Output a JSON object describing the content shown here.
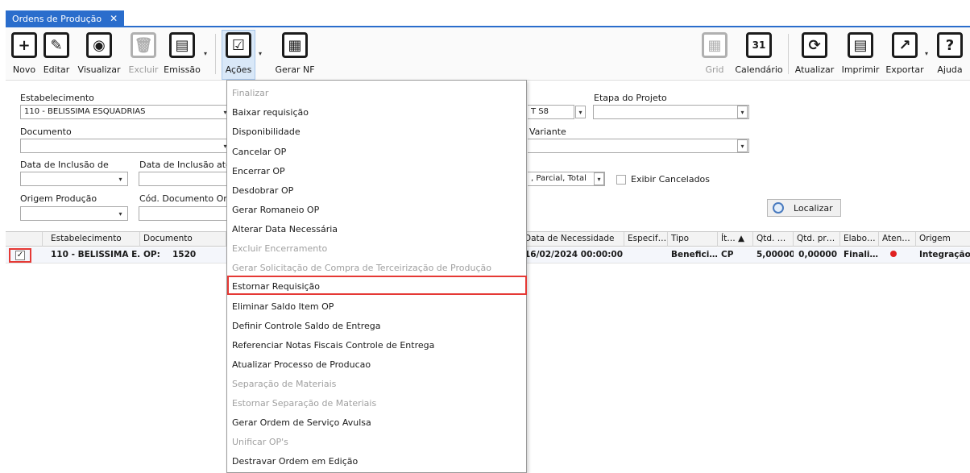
{
  "window": {
    "tab_title": "Ordens de Produção",
    "tab_close": "✕"
  },
  "toolbar": {
    "left": [
      {
        "label": "Novo",
        "icon": "plus-icon",
        "glyph": "+",
        "disabled": false
      },
      {
        "label": "Editar",
        "icon": "pencil-icon",
        "glyph": "✎",
        "disabled": false
      },
      {
        "label": "Visualizar",
        "icon": "eye-icon",
        "glyph": "◉",
        "disabled": false
      },
      {
        "label": "Excluir",
        "icon": "trash-icon",
        "glyph": "🗑",
        "disabled": true
      },
      {
        "label": "Emissão",
        "icon": "printer-icon",
        "glyph": "▤",
        "disabled": false
      },
      {
        "label": "Ações",
        "icon": "actions-icon",
        "glyph": "☑",
        "disabled": false
      },
      {
        "label": "Gerar NF",
        "icon": "invoice-icon",
        "glyph": "▦",
        "disabled": false
      }
    ],
    "right": [
      {
        "label": "Grid",
        "icon": "grid-icon",
        "glyph": "▦",
        "disabled": true
      },
      {
        "label": "Calendário",
        "icon": "calendar-icon",
        "glyph": "31",
        "disabled": false
      },
      {
        "label": "Atualizar",
        "icon": "refresh-icon",
        "glyph": "⟳",
        "disabled": false
      },
      {
        "label": "Imprimir",
        "icon": "print-icon",
        "glyph": "▤",
        "disabled": false
      },
      {
        "label": "Exportar",
        "icon": "export-icon",
        "glyph": "↗",
        "disabled": false
      },
      {
        "label": "Ajuda",
        "icon": "help-icon",
        "glyph": "?",
        "disabled": false
      }
    ]
  },
  "filters": {
    "estabelecimento_label": "Estabelecimento",
    "estabelecimento_value": "110 - BELISSIMA ESQUADRIAS",
    "documento_label": "Documento",
    "documento_value": "",
    "data_inclusao_de_label": "Data de Inclusão de",
    "data_inclusao_ate_label": "Data de Inclusão até",
    "origem_producao_label": "Origem Produção",
    "cod_doc_origem_label": "Cód. Documento Origem",
    "etapa_projeto_label": "Etapa do Projeto",
    "variante_label": "Variante",
    "partial_value_1": "T S8",
    "partial_value_2": ", Parcial, Total",
    "exibir_cancelados_label": "Exibir Cancelados",
    "localizar_label": "Localizar"
  },
  "grid": {
    "headers_left": [
      "Estabelecimento",
      "Documento"
    ],
    "headers_right": [
      "Data de Necessidade",
      "Especif…",
      "Tipo",
      "Ít… ▲",
      "Qtd. …",
      "Qtd. pr…",
      "Elabo…",
      "Aten…",
      "Origem"
    ],
    "row": {
      "checked": "✓",
      "estabelecimento": "110 - BELISSIMA E…",
      "documento_prefix": "OP:",
      "documento_num": "1520",
      "data_necessidade": "16/02/2024 00:00:00",
      "especif": "",
      "tipo": "Benefici…",
      "item": "CP",
      "qtd": "5,00000",
      "qtd_pr": "0,00000",
      "elabo": "Finali…",
      "origem": "Integração"
    }
  },
  "actions_menu": {
    "items": [
      {
        "label": "Finalizar",
        "disabled": true
      },
      {
        "label": "Baixar requisição",
        "disabled": false
      },
      {
        "label": "Disponibilidade",
        "disabled": false
      },
      {
        "label": "Cancelar OP",
        "disabled": false
      },
      {
        "label": "Encerrar OP",
        "disabled": false
      },
      {
        "label": "Desdobrar OP",
        "disabled": false
      },
      {
        "label": "Gerar Romaneio OP",
        "disabled": false
      },
      {
        "label": "Alterar Data Necessária",
        "disabled": false
      },
      {
        "label": "Excluir Encerramento",
        "disabled": true
      },
      {
        "label": "Gerar Solicitação de Compra de Terceirização de Produção",
        "disabled": true
      },
      {
        "label": "Estornar Requisição",
        "disabled": false,
        "highlighted": true
      },
      {
        "label": "Eliminar Saldo Item OP",
        "disabled": false
      },
      {
        "label": "Definir Controle Saldo de Entrega",
        "disabled": false
      },
      {
        "label": "Referenciar Notas Fiscais Controle de Entrega",
        "disabled": false
      },
      {
        "label": "Atualizar Processo de Producao",
        "disabled": false
      },
      {
        "label": "Separação de Materiais",
        "disabled": true
      },
      {
        "label": "Estornar Separação de Materiais",
        "disabled": true
      },
      {
        "label": "Gerar Ordem de Serviço Avulsa",
        "disabled": false
      },
      {
        "label": "Unificar OP's",
        "disabled": true
      },
      {
        "label": "Destravar Ordem em Edição",
        "disabled": false
      }
    ]
  },
  "colors": {
    "accent": "#2a6dcc",
    "highlight_border": "#e53935",
    "status_dot": "#e02020"
  }
}
